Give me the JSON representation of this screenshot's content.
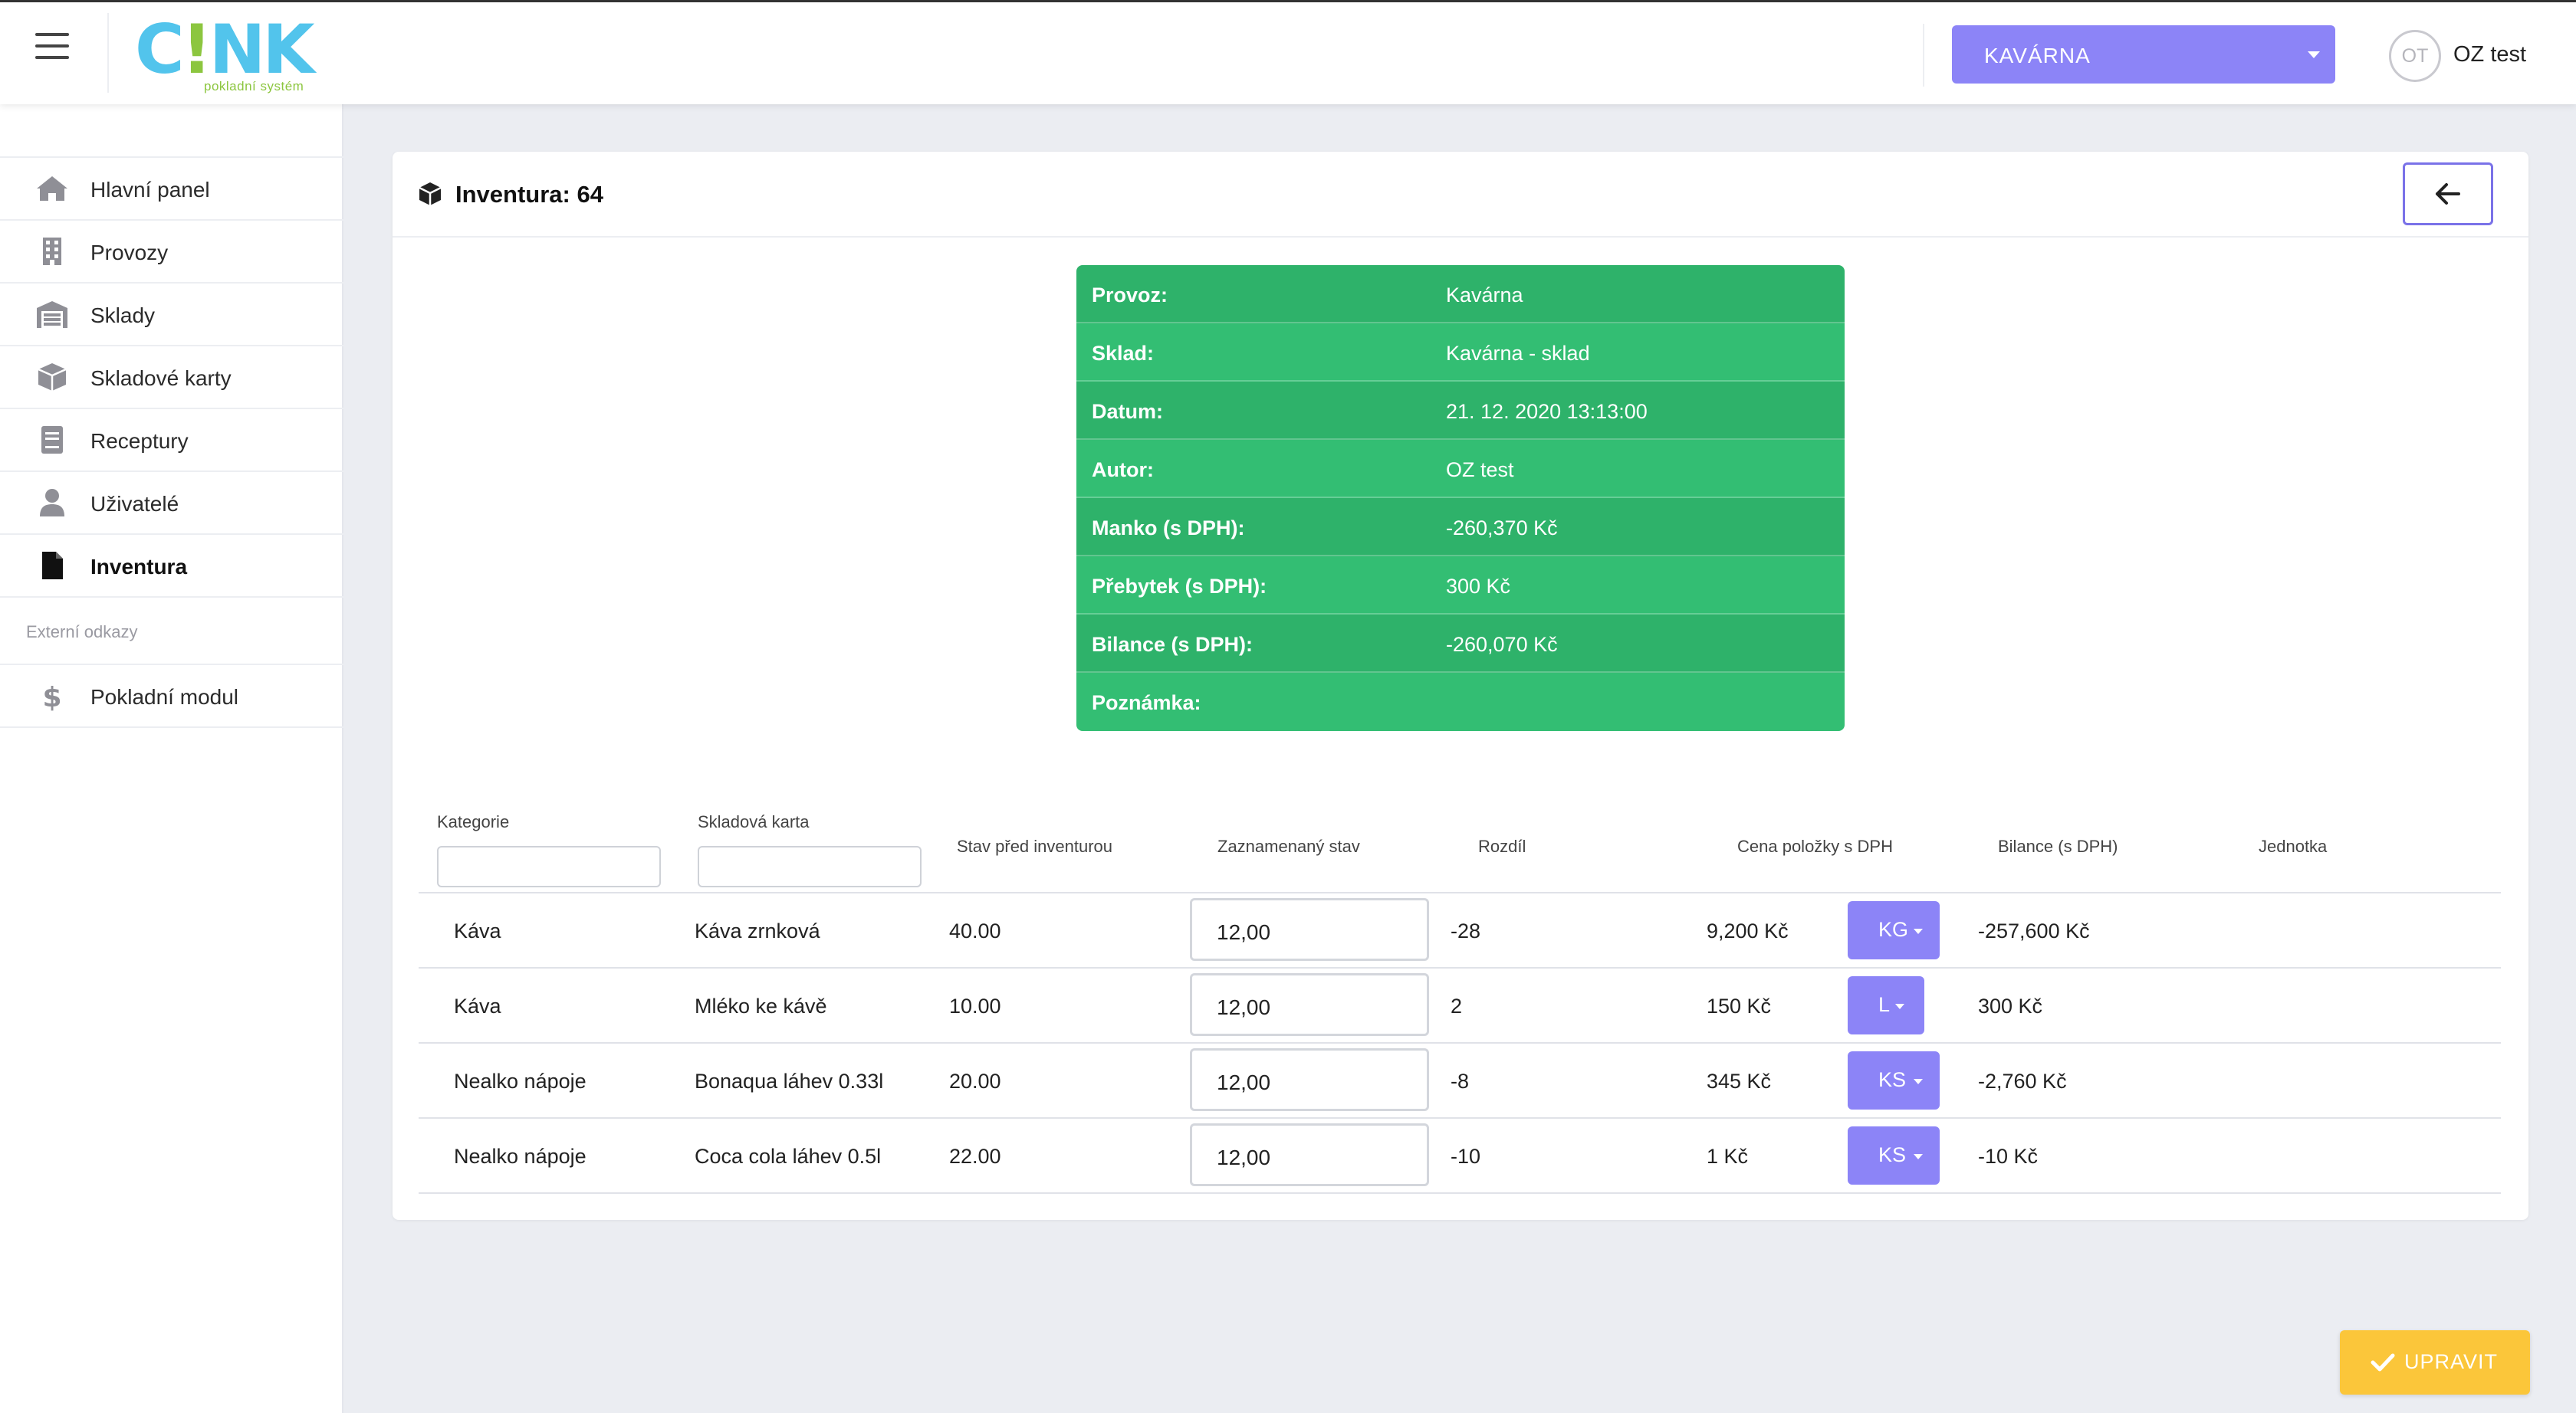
{
  "app": {
    "logo_text": "CINK",
    "logo_subtitle": "pokladní systém"
  },
  "header": {
    "branch_select": "KAVÁRNA",
    "avatar_initials": "OT",
    "user_name": "OZ test"
  },
  "sidebar": {
    "items": [
      {
        "label": "Hlavní panel",
        "icon": "home-icon"
      },
      {
        "label": "Provozy",
        "icon": "building-icon"
      },
      {
        "label": "Sklady",
        "icon": "warehouse-icon"
      },
      {
        "label": "Skladové karty",
        "icon": "box-icon"
      },
      {
        "label": "Receptury",
        "icon": "book-icon"
      },
      {
        "label": "Uživatelé",
        "icon": "user-icon"
      },
      {
        "label": "Inventura",
        "icon": "file-icon",
        "active": true
      }
    ],
    "external_section_label": "Externí odkazy",
    "external_items": [
      {
        "label": "Pokladní modul",
        "icon": "dollar-icon"
      }
    ]
  },
  "page": {
    "title": "Inventura: 64"
  },
  "info": [
    {
      "key": "Provoz:",
      "value": "Kavárna"
    },
    {
      "key": "Sklad:",
      "value": "Kavárna - sklad"
    },
    {
      "key": "Datum:",
      "value": "21. 12. 2020 13:13:00"
    },
    {
      "key": "Autor:",
      "value": "OZ test"
    },
    {
      "key": "Manko (s DPH):",
      "value": "-260,370 Kč"
    },
    {
      "key": "Přebytek (s DPH):",
      "value": "300 Kč"
    },
    {
      "key": "Bilance (s DPH):",
      "value": "-260,070 Kč"
    },
    {
      "key": "Poznámka:",
      "value": ""
    }
  ],
  "table": {
    "headers": {
      "category": "Kategorie",
      "card": "Skladová karta",
      "before": "Stav před inventurou",
      "recorded": "Zaznamenaný stav",
      "diff": "Rozdíl",
      "price": "Cena položky s DPH",
      "balance": "Bilance (s DPH)",
      "unit": "Jednotka"
    },
    "rows": [
      {
        "category": "Káva",
        "card": "Káva zrnková",
        "before": "40.00",
        "recorded": "12,00",
        "diff": "-28",
        "price": "9,200 Kč",
        "balance": "-257,600 Kč",
        "unit": "KG"
      },
      {
        "category": "Káva",
        "card": "Mléko ke kávě",
        "before": "10.00",
        "recorded": "12,00",
        "diff": "2",
        "price": "150 Kč",
        "balance": "300 Kč",
        "unit": "L"
      },
      {
        "category": "Nealko nápoje",
        "card": "Bonaqua láhev 0.33l",
        "before": "20.00",
        "recorded": "12,00",
        "diff": "-8",
        "price": "345 Kč",
        "balance": "-2,760 Kč",
        "unit": "KS"
      },
      {
        "category": "Nealko nápoje",
        "card": "Coca cola láhev 0.5l",
        "before": "22.00",
        "recorded": "12,00",
        "diff": "-10",
        "price": "1 Kč",
        "balance": "-10 Kč",
        "unit": "KS"
      }
    ]
  },
  "actions": {
    "edit_label": "UPRAVIT"
  },
  "colors": {
    "accent": "#8c84f7",
    "info_green": "#2eb26a",
    "edit_button": "#fbc63a",
    "logo_blue": "#52c4ec",
    "logo_green": "#8cc63f"
  }
}
